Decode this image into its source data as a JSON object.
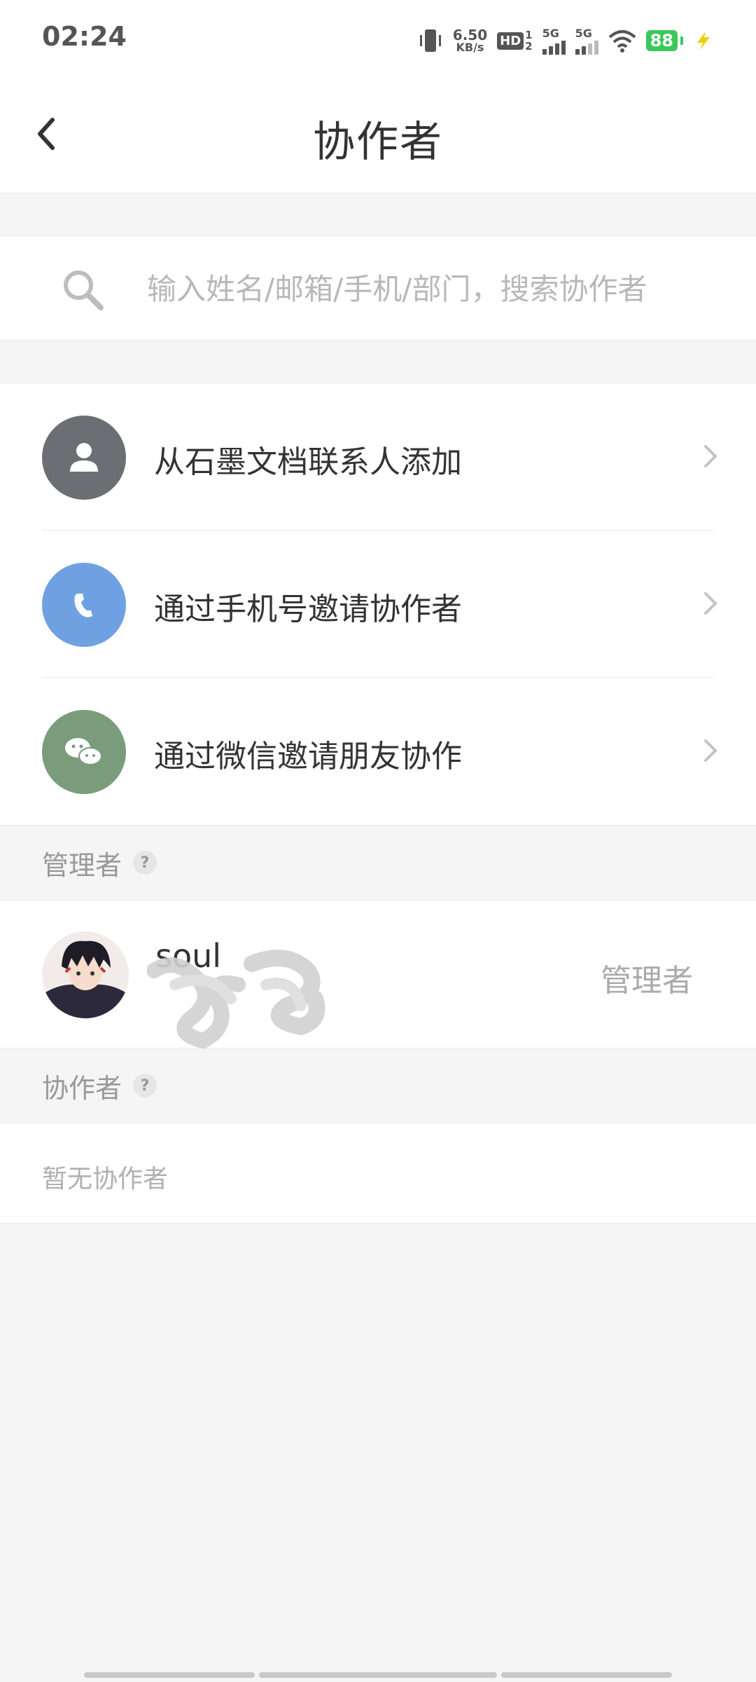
{
  "status_bar": {
    "time": "02:24",
    "net_speed_value": "6.50",
    "net_speed_unit": "KB/s",
    "hd_label": "HD",
    "hd_sub_top": "1",
    "hd_sub_bottom": "2",
    "signal1_label": "5G",
    "signal2_label": "5G",
    "battery": "88"
  },
  "navbar": {
    "title": "协作者"
  },
  "search": {
    "placeholder": "输入姓名/邮箱/手机/部门，搜索协作者"
  },
  "actions": [
    {
      "label": "从石墨文档联系人添加",
      "icon": "contact-icon",
      "color": "#6b6e72"
    },
    {
      "label": "通过手机号邀请协作者",
      "icon": "phone-icon",
      "color": "#6fa1e2"
    },
    {
      "label": "通过微信邀请朋友协作",
      "icon": "wechat-icon",
      "color": "#7a9c7b"
    }
  ],
  "admins_section": {
    "title": "管理者",
    "help": "?"
  },
  "admin_user": {
    "name": "soul",
    "role": "管理者"
  },
  "collaborators_section": {
    "title": "协作者",
    "help": "?",
    "empty_text": "暂无协作者"
  }
}
